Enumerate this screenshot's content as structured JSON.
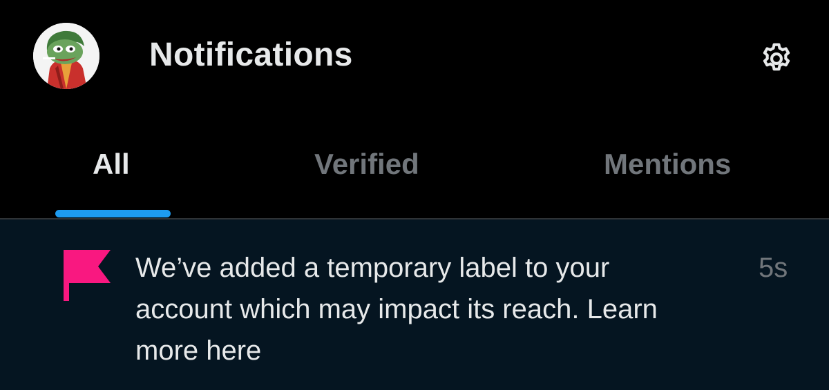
{
  "header": {
    "title": "Notifications",
    "avatar_icon": "pepe-joker-avatar",
    "settings_icon": "gear-icon"
  },
  "tabs": [
    {
      "label": "All",
      "active": true
    },
    {
      "label": "Verified",
      "active": false
    },
    {
      "label": "Mentions",
      "active": false
    }
  ],
  "notification": {
    "icon": "flag-icon",
    "text": "We’ve added a temporary label to your account which may impact its reach. Learn more here",
    "time": "5s"
  },
  "colors": {
    "background": "#000000",
    "notification_background": "#051521",
    "accent": "#1d9bf0",
    "flag": "#f91880",
    "primary_text": "#e7e9ea",
    "secondary_text": "#71767b"
  }
}
